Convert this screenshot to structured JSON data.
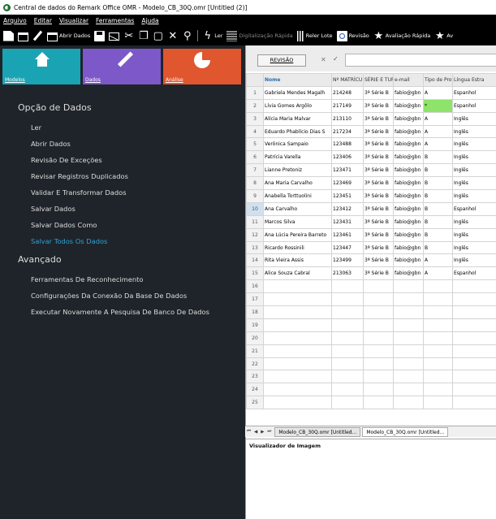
{
  "window": {
    "title": "Central de dados do Remark Office OMR - Modelo_CB_30Q.omr [Untitled (2)]"
  },
  "menu": [
    "Arquivo",
    "Editar",
    "Visualizar",
    "Ferramentas",
    "Ajuda"
  ],
  "toolbar": {
    "open_data": "Abrir Dados",
    "quick_scan": "Digitalização Rápida",
    "reread_batch": "Reler Lote",
    "review": "Revisão",
    "quick_eval": "Avaliação Rápida",
    "eval_cut": "Av"
  },
  "tiles": {
    "models": "Modelos",
    "data": "Dados",
    "analysis": "Análise"
  },
  "data_options": {
    "title": "Opção de Dados",
    "items": [
      "Ler",
      "Abrir Dados",
      "Revisão De Exceções",
      "Revisar Registros Duplicados",
      "Validar E Transformar Dados",
      "Salvar Dados",
      "Salvar Dados Como",
      "Salvar Todos Os Dados"
    ]
  },
  "advanced": {
    "title": "Avançado",
    "items": [
      "Ferramentas De Reconhecimento",
      "Configurações Da Conexão Da Base De Dados",
      "Executar Novamente A Pesquisa De Banco De Dados"
    ]
  },
  "grid": {
    "view_tab": "REVISÃO",
    "columns": [
      "Nome",
      "Nº MATRÍCU",
      "SÉRIE E TUR",
      "e-mail",
      "Tipo de Prov",
      "Língua Estra"
    ],
    "rows": [
      [
        "Gabriela Mendes Magalh",
        "214248",
        "3ª Série B",
        "fabio@gbn",
        "A",
        "Espanhol"
      ],
      [
        "Lívia Gomes Argôlo",
        "217149",
        "3ª Série B",
        "fabio@gbn",
        "*",
        "Espanhol"
      ],
      [
        "Alícia Maria Malvar",
        "213110",
        "3ª Série B",
        "fabio@gbn",
        "A",
        "Inglês"
      ],
      [
        "Eduardo Phablício Dias S",
        "217234",
        "3ª Série B",
        "fabio@gbn",
        "A",
        "Inglês"
      ],
      [
        "Verônica Sampaio",
        "123488",
        "3ª Série B",
        "fabio@gbn",
        "A",
        "Inglês"
      ],
      [
        "Patrícia Varella",
        "123406",
        "3ª Série B",
        "fabio@gbn",
        "B",
        "Inglês"
      ],
      [
        "Lianne Pretoniz",
        "123471",
        "3ª Série B",
        "fabio@gbn",
        "B",
        "Inglês"
      ],
      [
        "Ana Maria Carvalho",
        "123469",
        "3ª Série B",
        "fabio@gbn",
        "B",
        "Inglês"
      ],
      [
        "Anabella Torttuolini",
        "123451",
        "3ª Série B",
        "fabio@gbn",
        "B",
        "Inglês"
      ],
      [
        "Ana Carvalho",
        "123412",
        "3ª Série B",
        "fabio@gbn",
        "B",
        "Espanhol"
      ],
      [
        "Marcos Silva",
        "123431",
        "3ª Série B",
        "fabio@gbn",
        "B",
        "Inglês"
      ],
      [
        "Ana Lúcia Pereira Barreto",
        "123461",
        "3ª Série B",
        "fabio@gbn",
        "B",
        "Inglês"
      ],
      [
        "Ricardo Rossinili",
        "123447",
        "3ª Série B",
        "fabio@gbn",
        "B",
        "Inglês"
      ],
      [
        "Rita Vieira Assis",
        "123499",
        "3ª Série B",
        "fabio@gbn",
        "A",
        "Inglês"
      ],
      [
        "Alice Souza Cabral",
        "213063",
        "3ª Série B",
        "fabio@gbn",
        "A",
        "Espanhol"
      ]
    ],
    "total_rows": 25
  },
  "sheet_tabs": [
    "Modelo_CB_30Q.omr [Untitled...",
    "Modelo_CB_30Q.omr [Untitled..."
  ],
  "image_viewer": {
    "title": "Visualizador de Imagem"
  },
  "colors": {
    "models": "#1aa3b3",
    "data": "#7c58c8",
    "analysis": "#e0562e",
    "active_option": "#2ea3d6",
    "highlight_cell": "#8ee36a"
  }
}
